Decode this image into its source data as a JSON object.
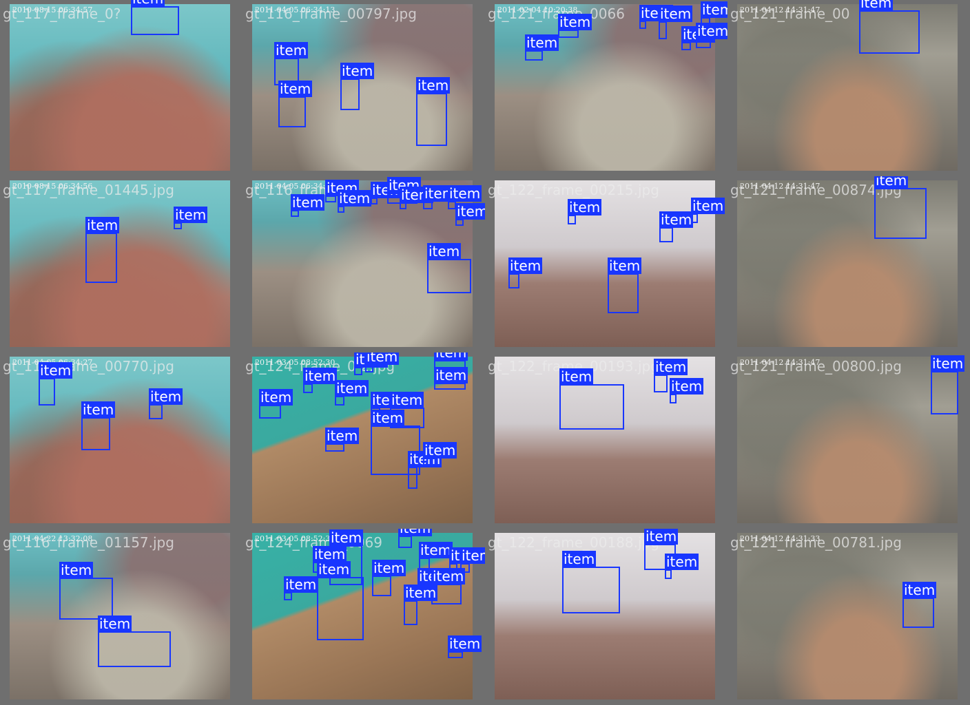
{
  "label": "item",
  "colors": {
    "box": "#1836ff",
    "border": "#6f6f6f"
  },
  "images": [
    {
      "caption": "gt_117_frame_0?",
      "stamp": "2010-08-15 06:34:57",
      "palette": "p-cyan"
    },
    {
      "caption": "gt_116_frame_00797.jpg",
      "stamp": "2011-04-05 06:34:13",
      "palette": "p-rock"
    },
    {
      "caption": "gt_121_frame_0066",
      "stamp": "2011-02-04 10:20:38",
      "palette": "p-rock"
    },
    {
      "caption": "gt_121_frame_00",
      "stamp": "2011-04-12 14:31:47",
      "palette": "p-gray"
    },
    {
      "caption": "gt_117_frame_01445.jpg",
      "stamp": "2010-08-15 06:34:56",
      "palette": "p-cyan"
    },
    {
      "caption": "gt_116_frame_0",
      "stamp": "2011-04-05 06:34:13",
      "palette": "p-rock"
    },
    {
      "caption": "gt_122_frame_00215.jpg",
      "stamp": "",
      "palette": "p-fog"
    },
    {
      "caption": "gt_121_frame_00874.jpg",
      "stamp": "2011-04-12 14:31:47",
      "palette": "p-gray"
    },
    {
      "caption": "gt_117_frame_00770.jpg",
      "stamp": "2011-04-05 06:34:27",
      "palette": "p-cyan"
    },
    {
      "caption": "gt_124_frame_0 2.jpg",
      "stamp": "2011-03-05 08:52:30",
      "palette": "p-sand"
    },
    {
      "caption": "gt_122_frame_00193.jpg",
      "stamp": "",
      "palette": "p-fog"
    },
    {
      "caption": "gt_121_frame_00800.jpg",
      "stamp": "2011-04-12 14:31:47",
      "palette": "p-gray"
    },
    {
      "caption": "gt_116_frame_01157.jpg",
      "stamp": "2011-04-22 13:32:08",
      "palette": "p-rock"
    },
    {
      "caption": "gt_124_frame_0069",
      "stamp": "2011-03-05 08:52:30",
      "palette": "p-sand"
    },
    {
      "caption": "gt_122_frame_00188.jpg",
      "stamp": "",
      "palette": "p-fog"
    },
    {
      "caption": "gt_121_frame_00781.jpg",
      "stamp": "2011-04-12 14:31:33",
      "palette": "p-gray"
    }
  ]
}
